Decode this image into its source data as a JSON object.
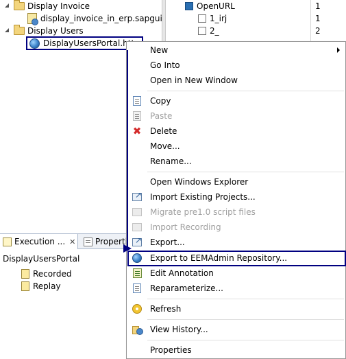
{
  "left_tree": {
    "items": [
      {
        "label": "Display Invoice"
      },
      {
        "label": "display_invoice_in_erp.sapgui"
      },
      {
        "label": "Display Users"
      },
      {
        "label": "DisplayUsersPortal.http"
      }
    ]
  },
  "right_pane": {
    "rows": [
      {
        "label": "OpenURL",
        "value": "1"
      },
      {
        "label": "1_irj",
        "value": "1"
      },
      {
        "label": "2_",
        "value": "2"
      }
    ]
  },
  "bottom_panel": {
    "tabs": [
      {
        "label": "Execution ..."
      },
      {
        "label": "Properti"
      }
    ],
    "close_glyph": "✕",
    "title": "DisplayUsersPortal",
    "items": [
      {
        "label": "Recorded"
      },
      {
        "label": "Replay"
      }
    ]
  },
  "context_menu": {
    "items": [
      {
        "label": "New",
        "icon": "none",
        "submenu": true
      },
      {
        "label": "Go Into",
        "icon": "none"
      },
      {
        "label": "Open in New Window",
        "icon": "none"
      },
      {
        "label": "Copy",
        "icon": "copy-icon"
      },
      {
        "label": "Paste",
        "icon": "paste-icon",
        "disabled": true
      },
      {
        "label": "Delete",
        "icon": "delete-icon"
      },
      {
        "label": "Move...",
        "icon": "none"
      },
      {
        "label": "Rename...",
        "icon": "none"
      },
      {
        "label": "Open Windows Explorer",
        "icon": "none"
      },
      {
        "label": "Import Existing Projects...",
        "icon": "import-icon"
      },
      {
        "label": "Migrate pre1.0 script files",
        "icon": "migrate-icon",
        "disabled": true
      },
      {
        "label": "Import Recording",
        "icon": "import-recording-icon",
        "disabled": true
      },
      {
        "label": "Export...",
        "icon": "export-icon"
      },
      {
        "label": "Export to EEMAdmin Repository...",
        "icon": "globe-icon",
        "highlighted": true
      },
      {
        "label": "Edit Annotation",
        "icon": "annotation-icon"
      },
      {
        "label": "Reparameterize...",
        "icon": "reparameterize-icon"
      },
      {
        "label": "Refresh",
        "icon": "refresh-icon"
      },
      {
        "label": "View History...",
        "icon": "history-icon"
      },
      {
        "label": "Properties",
        "icon": "none"
      }
    ]
  },
  "colors": {
    "annotation_border": "#000080",
    "disabled_text": "#a0a0a0",
    "delete_icon": "#d42b2b"
  }
}
